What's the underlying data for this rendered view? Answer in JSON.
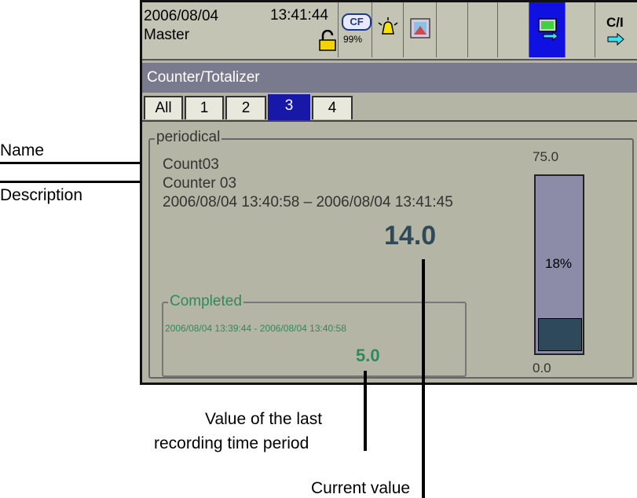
{
  "status": {
    "date": "2006/08/04",
    "time": "13:41:44",
    "user": "Master",
    "cf_label": "CF",
    "cf_percent": "99%",
    "icons": [
      "lock-icon",
      "alarm-bell-icon",
      "display-icon",
      "transfer-icon",
      "counter-icon"
    ],
    "counter_label": "C/I"
  },
  "window_title": "Counter/Totalizer",
  "tabs": [
    {
      "label": "All"
    },
    {
      "label": "1"
    },
    {
      "label": "2"
    },
    {
      "label": "3",
      "active": true
    },
    {
      "label": "4"
    }
  ],
  "periodical": {
    "title": "periodical",
    "name": "Count03",
    "description": "Counter 03",
    "range": "2006/08/04  13:40:58  –  2006/08/04  13:41:45",
    "current_value": "14.0"
  },
  "completed": {
    "title": "Completed",
    "range": "2006/08/04 13:39:44  -   2006/08/04 13:40:58",
    "value": "5.0"
  },
  "gauge": {
    "max": "75.0",
    "min": "0.0",
    "percent_label": "18%",
    "fill_fraction": 0.18
  },
  "callouts": {
    "name": "Name",
    "description": "Description",
    "last_period": [
      "Value of the last",
      "recording time period"
    ],
    "current": "Current value"
  },
  "colors": {
    "screen_bg": "#b5b5a5",
    "title_bar": "#7a7a8e",
    "active_tab": "#1818a8",
    "value_color": "#2e4a5a",
    "completed_color": "#2e8a5a"
  }
}
